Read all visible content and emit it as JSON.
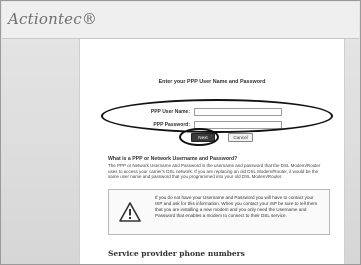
{
  "brand": {
    "logo_text": "Actiontec®"
  },
  "form": {
    "heading": "Enter your PPP User Name and Password",
    "user_name_label": "PPP User Name:",
    "password_label": "PPP Password:",
    "user_name_value": "",
    "password_value": "",
    "next_label": "Next",
    "cancel_label": "Cancel"
  },
  "info": {
    "title": "What is a PPP or Network Username and Password?",
    "body": "The PPP or Network Username and Password is the username and password that the DSL Modem/Router uses to access your carrier's DSL network. If you are replacing an old DSL Modem/Router, it would be the same user name and password that you programmed into your old DSL Modem/Router."
  },
  "warning": {
    "icon": "warning-triangle-icon",
    "text": "If you do not have your Username and Password you will have to contact your ISP and ask for this information. When you contact your ISP be sure to tell them that you are installing a new modem and you only need the Username and Password that enables a modem to connect to their DSL service."
  },
  "provider": {
    "heading": "Service provider phone numbers"
  },
  "colors": {
    "annotation": "#111111",
    "next_button": "#3a3a3a"
  }
}
